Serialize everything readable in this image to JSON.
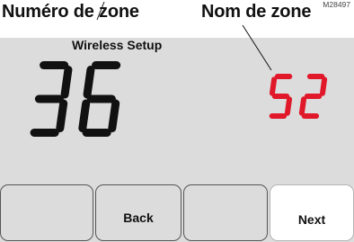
{
  "callouts": {
    "zone_number_label": "Numéro de zone",
    "zone_name_label": "Nom de zone",
    "figure_code": "M28497"
  },
  "screen": {
    "title": "Wireless Setup",
    "zone_number": "36",
    "zone_name": "52",
    "zone_name_color": "#e0182a",
    "zone_number_color": "#111111"
  },
  "softkeys": [
    {
      "label": ""
    },
    {
      "label": "Back"
    },
    {
      "label": ""
    },
    {
      "label": "Next"
    }
  ]
}
